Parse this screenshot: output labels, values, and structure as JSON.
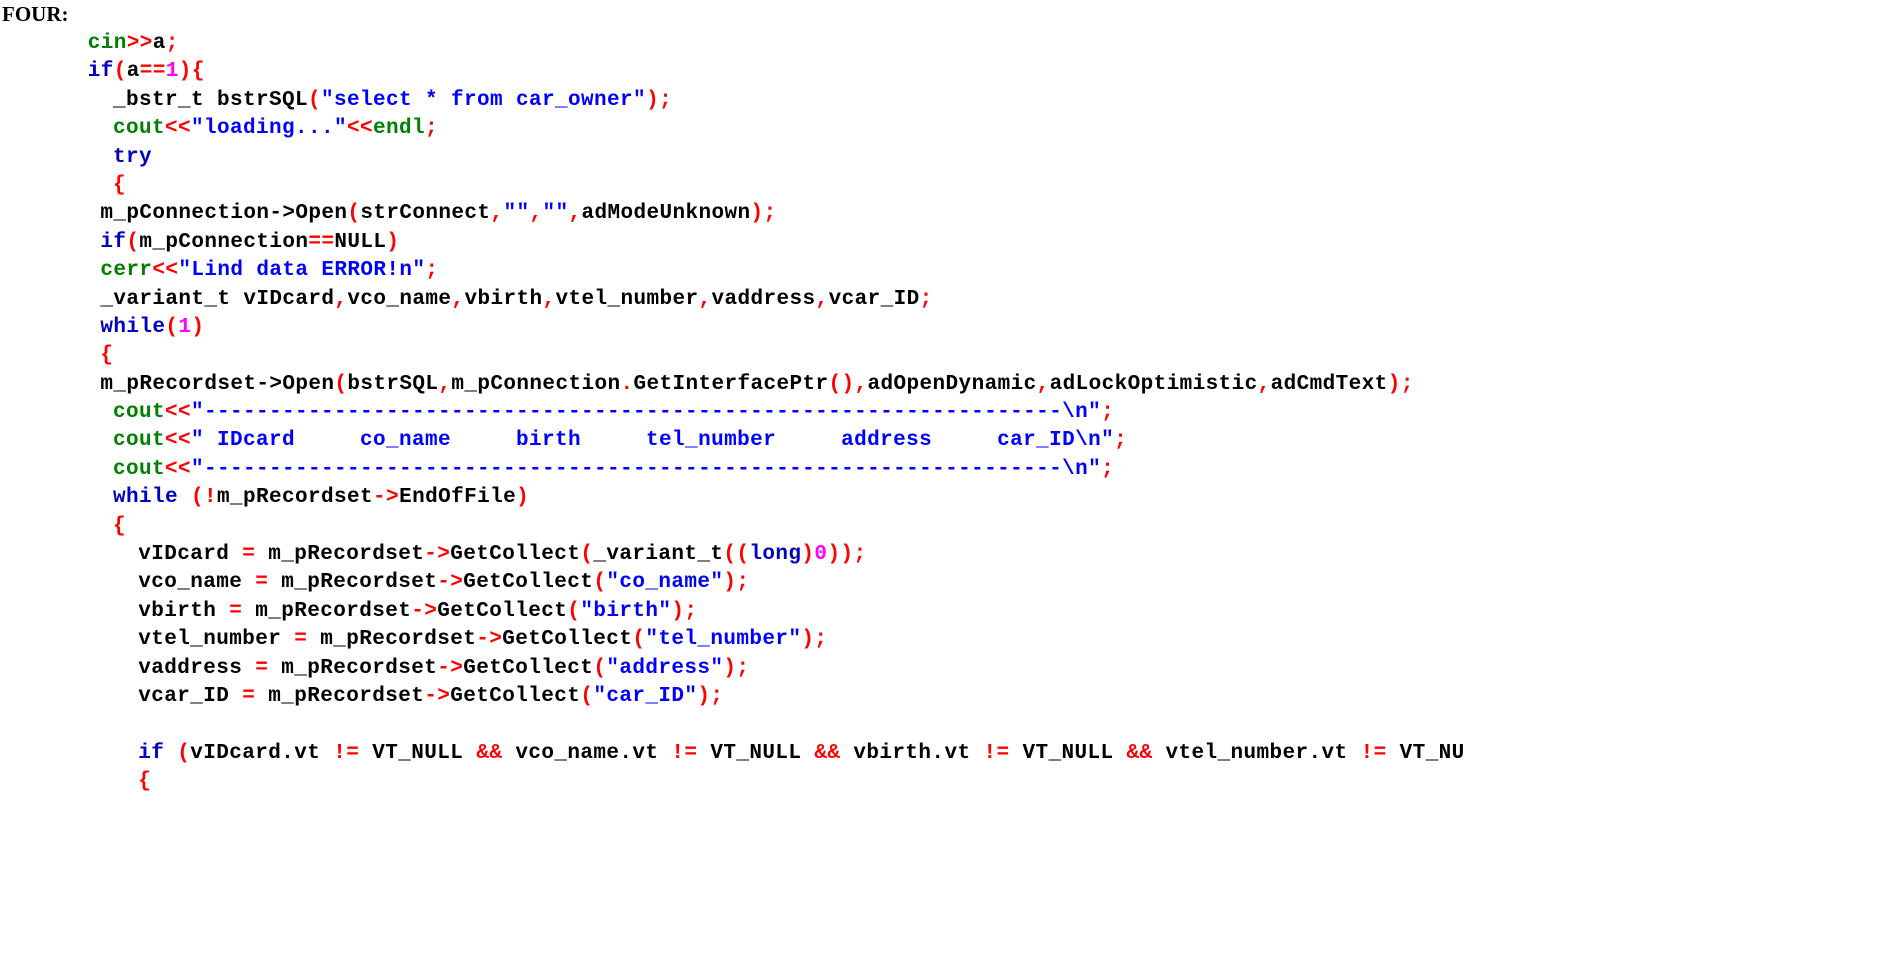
{
  "document": {
    "heading": "FOUR:",
    "language": "cpp",
    "background_color": "#ffffff",
    "colors": {
      "plain": "#000000",
      "keyword": "#0000c0",
      "string": "#0000ff",
      "stream_object": "#008000",
      "punctuation": "#ff0000",
      "number": "#ff00ff",
      "operator": "#ff0000"
    }
  },
  "code": {
    "lines": [
      {
        "indent": 6,
        "tokens": [
          {
            "t": "cin",
            "c": "stream"
          },
          {
            "t": ">>",
            "c": "punctuation"
          },
          {
            "t": "a",
            "c": "plain"
          },
          {
            "t": ";",
            "c": "punctuation"
          }
        ],
        "plain_text": "cin>>a;"
      },
      {
        "indent": 6,
        "tokens": [
          {
            "t": "if",
            "c": "keyword"
          },
          {
            "t": "(",
            "c": "punctuation"
          },
          {
            "t": "a",
            "c": "plain"
          },
          {
            "t": "==",
            "c": "operator"
          },
          {
            "t": "1",
            "c": "number"
          },
          {
            "t": ")",
            "c": "punctuation"
          },
          {
            "t": "{",
            "c": "punctuation"
          }
        ],
        "plain_text": "if(a==1){"
      },
      {
        "indent": 8,
        "tokens": [
          {
            "t": "_bstr_t bstrSQL",
            "c": "plain"
          },
          {
            "t": "(",
            "c": "punctuation"
          },
          {
            "t": "\"select * from car_owner\"",
            "c": "string"
          },
          {
            "t": ")",
            "c": "punctuation"
          },
          {
            "t": ";",
            "c": "punctuation"
          }
        ],
        "plain_text": "_bstr_t bstrSQL(\"select * from car_owner\");"
      },
      {
        "indent": 8,
        "tokens": [
          {
            "t": "cout",
            "c": "stream"
          },
          {
            "t": "<<",
            "c": "punctuation"
          },
          {
            "t": "\"loading...\"",
            "c": "string"
          },
          {
            "t": "<<",
            "c": "punctuation"
          },
          {
            "t": "endl",
            "c": "stream"
          },
          {
            "t": ";",
            "c": "punctuation"
          }
        ],
        "plain_text": "cout<<\"loading...\"<<endl;"
      },
      {
        "indent": 8,
        "tokens": [
          {
            "t": "try",
            "c": "keyword"
          }
        ],
        "plain_text": "try"
      },
      {
        "indent": 8,
        "tokens": [
          {
            "t": "{",
            "c": "punctuation"
          }
        ],
        "plain_text": "{"
      },
      {
        "indent": 7,
        "tokens": [
          {
            "t": "m_pConnection->Open",
            "c": "plain"
          },
          {
            "t": "(",
            "c": "punctuation"
          },
          {
            "t": "strConnect",
            "c": "plain"
          },
          {
            "t": ",",
            "c": "punctuation"
          },
          {
            "t": "\"\"",
            "c": "string"
          },
          {
            "t": ",",
            "c": "punctuation"
          },
          {
            "t": "\"\"",
            "c": "string"
          },
          {
            "t": ",",
            "c": "punctuation"
          },
          {
            "t": "adModeUnknown",
            "c": "plain"
          },
          {
            "t": ")",
            "c": "punctuation"
          },
          {
            "t": ";",
            "c": "punctuation"
          }
        ],
        "plain_text": "m_pConnection->Open(strConnect,\"\",\"\",adModeUnknown);"
      },
      {
        "indent": 7,
        "tokens": [
          {
            "t": "if",
            "c": "keyword"
          },
          {
            "t": "(",
            "c": "punctuation"
          },
          {
            "t": "m_pConnection",
            "c": "plain"
          },
          {
            "t": "==",
            "c": "operator"
          },
          {
            "t": "NULL",
            "c": "plain"
          },
          {
            "t": ")",
            "c": "punctuation"
          }
        ],
        "plain_text": "if(m_pConnection==NULL)"
      },
      {
        "indent": 7,
        "tokens": [
          {
            "t": "cerr",
            "c": "stream"
          },
          {
            "t": "<<",
            "c": "punctuation"
          },
          {
            "t": "\"Lind data ERROR!n\"",
            "c": "string"
          },
          {
            "t": ";",
            "c": "punctuation"
          }
        ],
        "plain_text": "cerr<<\"Lind data ERROR!n\";"
      },
      {
        "indent": 7,
        "tokens": [
          {
            "t": "_variant_t vIDcard",
            "c": "plain"
          },
          {
            "t": ",",
            "c": "punctuation"
          },
          {
            "t": "vco_name",
            "c": "plain"
          },
          {
            "t": ",",
            "c": "punctuation"
          },
          {
            "t": "vbirth",
            "c": "plain"
          },
          {
            "t": ",",
            "c": "punctuation"
          },
          {
            "t": "vtel_number",
            "c": "plain"
          },
          {
            "t": ",",
            "c": "punctuation"
          },
          {
            "t": "vaddress",
            "c": "plain"
          },
          {
            "t": ",",
            "c": "punctuation"
          },
          {
            "t": "vcar_ID",
            "c": "plain"
          },
          {
            "t": ";",
            "c": "punctuation"
          }
        ],
        "plain_text": "_variant_t vIDcard,vco_name,vbirth,vtel_number,vaddress,vcar_ID;"
      },
      {
        "indent": 7,
        "tokens": [
          {
            "t": "while",
            "c": "keyword"
          },
          {
            "t": "(",
            "c": "punctuation"
          },
          {
            "t": "1",
            "c": "number"
          },
          {
            "t": ")",
            "c": "punctuation"
          }
        ],
        "plain_text": "while(1)"
      },
      {
        "indent": 7,
        "tokens": [
          {
            "t": "{",
            "c": "punctuation"
          }
        ],
        "plain_text": "{"
      },
      {
        "indent": 7,
        "tokens": [
          {
            "t": "m_pRecordset->Open",
            "c": "plain"
          },
          {
            "t": "(",
            "c": "punctuation"
          },
          {
            "t": "bstrSQL",
            "c": "plain"
          },
          {
            "t": ",",
            "c": "punctuation"
          },
          {
            "t": "m_pConnection",
            "c": "plain"
          },
          {
            "t": ".",
            "c": "punctuation"
          },
          {
            "t": "GetInterfacePtr",
            "c": "plain"
          },
          {
            "t": "(",
            "c": "punctuation"
          },
          {
            "t": ")",
            "c": "punctuation"
          },
          {
            "t": ",",
            "c": "punctuation"
          },
          {
            "t": "adOpenDynamic",
            "c": "plain"
          },
          {
            "t": ",",
            "c": "punctuation"
          },
          {
            "t": "adLockOptimistic",
            "c": "plain"
          },
          {
            "t": ",",
            "c": "punctuation"
          },
          {
            "t": "adCmdText",
            "c": "plain"
          },
          {
            "t": ")",
            "c": "punctuation"
          },
          {
            "t": ";",
            "c": "punctuation"
          }
        ],
        "plain_text": "m_pRecordset->Open(bstrSQL,m_pConnection.GetInterfacePtr(),adOpenDynamic,adLockOptimistic,adCmdText);"
      },
      {
        "indent": 8,
        "tokens": [
          {
            "t": "cout",
            "c": "stream"
          },
          {
            "t": "<<",
            "c": "punctuation"
          },
          {
            "t": "\"------------------------------------------------------------------",
            "c": "string"
          },
          {
            "t": "\\n",
            "c": "string"
          },
          {
            "t": "\"",
            "c": "string"
          },
          {
            "t": ";",
            "c": "punctuation"
          }
        ],
        "plain_text": "cout<<\"------------------------------------------------------------------\\n\";"
      },
      {
        "indent": 8,
        "tokens": [
          {
            "t": "cout",
            "c": "stream"
          },
          {
            "t": "<<",
            "c": "punctuation"
          },
          {
            "t": "\" IDcard     co_name     birth     tel_number     address     car_ID\\n\"",
            "c": "string"
          },
          {
            "t": ";",
            "c": "punctuation"
          }
        ],
        "plain_text": "cout<<\" IDcard     co_name     birth     tel_number     address     car_ID\\n\";"
      },
      {
        "indent": 8,
        "tokens": [
          {
            "t": "cout",
            "c": "stream"
          },
          {
            "t": "<<",
            "c": "punctuation"
          },
          {
            "t": "\"------------------------------------------------------------------",
            "c": "string"
          },
          {
            "t": "\\n",
            "c": "string"
          },
          {
            "t": "\"",
            "c": "string"
          },
          {
            "t": ";",
            "c": "punctuation"
          }
        ],
        "plain_text": "cout<<\"------------------------------------------------------------------\\n\";"
      },
      {
        "indent": 8,
        "tokens": [
          {
            "t": "while",
            "c": "keyword"
          },
          {
            "t": " ",
            "c": "plain"
          },
          {
            "t": "(",
            "c": "punctuation"
          },
          {
            "t": "!",
            "c": "operator"
          },
          {
            "t": "m_pRecordset",
            "c": "plain"
          },
          {
            "t": "->",
            "c": "punctuation"
          },
          {
            "t": "EndOfFile",
            "c": "plain"
          },
          {
            "t": ")",
            "c": "punctuation"
          }
        ],
        "plain_text": "while (!m_pRecordset->EndOfFile)"
      },
      {
        "indent": 8,
        "tokens": [
          {
            "t": "{",
            "c": "punctuation"
          }
        ],
        "plain_text": "{"
      },
      {
        "indent": 10,
        "tokens": [
          {
            "t": "vIDcard ",
            "c": "plain"
          },
          {
            "t": "=",
            "c": "operator"
          },
          {
            "t": " m_pRecordset",
            "c": "plain"
          },
          {
            "t": "->",
            "c": "punctuation"
          },
          {
            "t": "GetCollect",
            "c": "plain"
          },
          {
            "t": "(",
            "c": "punctuation"
          },
          {
            "t": "_variant_t",
            "c": "plain"
          },
          {
            "t": "(",
            "c": "punctuation"
          },
          {
            "t": "(",
            "c": "punctuation"
          },
          {
            "t": "long",
            "c": "keyword"
          },
          {
            "t": ")",
            "c": "punctuation"
          },
          {
            "t": "0",
            "c": "number"
          },
          {
            "t": ")",
            "c": "punctuation"
          },
          {
            "t": ")",
            "c": "punctuation"
          },
          {
            "t": ";",
            "c": "punctuation"
          }
        ],
        "plain_text": "vIDcard = m_pRecordset->GetCollect(_variant_t((long)0));"
      },
      {
        "indent": 10,
        "tokens": [
          {
            "t": "vco_name ",
            "c": "plain"
          },
          {
            "t": "=",
            "c": "operator"
          },
          {
            "t": " m_pRecordset",
            "c": "plain"
          },
          {
            "t": "->",
            "c": "punctuation"
          },
          {
            "t": "GetCollect",
            "c": "plain"
          },
          {
            "t": "(",
            "c": "punctuation"
          },
          {
            "t": "\"co_name\"",
            "c": "string"
          },
          {
            "t": ")",
            "c": "punctuation"
          },
          {
            "t": ";",
            "c": "punctuation"
          }
        ],
        "plain_text": "vco_name = m_pRecordset->GetCollect(\"co_name\");"
      },
      {
        "indent": 10,
        "tokens": [
          {
            "t": "vbirth ",
            "c": "plain"
          },
          {
            "t": "=",
            "c": "operator"
          },
          {
            "t": " m_pRecordset",
            "c": "plain"
          },
          {
            "t": "->",
            "c": "punctuation"
          },
          {
            "t": "GetCollect",
            "c": "plain"
          },
          {
            "t": "(",
            "c": "punctuation"
          },
          {
            "t": "\"birth\"",
            "c": "string"
          },
          {
            "t": ")",
            "c": "punctuation"
          },
          {
            "t": ";",
            "c": "punctuation"
          }
        ],
        "plain_text": "vbirth = m_pRecordset->GetCollect(\"birth\");"
      },
      {
        "indent": 10,
        "tokens": [
          {
            "t": "vtel_number ",
            "c": "plain"
          },
          {
            "t": "=",
            "c": "operator"
          },
          {
            "t": " m_pRecordset",
            "c": "plain"
          },
          {
            "t": "->",
            "c": "punctuation"
          },
          {
            "t": "GetCollect",
            "c": "plain"
          },
          {
            "t": "(",
            "c": "punctuation"
          },
          {
            "t": "\"tel_number\"",
            "c": "string"
          },
          {
            "t": ")",
            "c": "punctuation"
          },
          {
            "t": ";",
            "c": "punctuation"
          }
        ],
        "plain_text": "vtel_number = m_pRecordset->GetCollect(\"tel_number\");"
      },
      {
        "indent": 10,
        "tokens": [
          {
            "t": "vaddress ",
            "c": "plain"
          },
          {
            "t": "=",
            "c": "operator"
          },
          {
            "t": " m_pRecordset",
            "c": "plain"
          },
          {
            "t": "->",
            "c": "punctuation"
          },
          {
            "t": "GetCollect",
            "c": "plain"
          },
          {
            "t": "(",
            "c": "punctuation"
          },
          {
            "t": "\"address\"",
            "c": "string"
          },
          {
            "t": ")",
            "c": "punctuation"
          },
          {
            "t": ";",
            "c": "punctuation"
          }
        ],
        "plain_text": "vaddress = m_pRecordset->GetCollect(\"address\");"
      },
      {
        "indent": 10,
        "tokens": [
          {
            "t": "vcar_ID ",
            "c": "plain"
          },
          {
            "t": "=",
            "c": "operator"
          },
          {
            "t": " m_pRecordset",
            "c": "plain"
          },
          {
            "t": "->",
            "c": "punctuation"
          },
          {
            "t": "GetCollect",
            "c": "plain"
          },
          {
            "t": "(",
            "c": "punctuation"
          },
          {
            "t": "\"car_ID\"",
            "c": "string"
          },
          {
            "t": ")",
            "c": "punctuation"
          },
          {
            "t": ";",
            "c": "punctuation"
          }
        ],
        "plain_text": "vcar_ID = m_pRecordset->GetCollect(\"car_ID\");"
      },
      {
        "indent": 0,
        "tokens": [],
        "plain_text": ""
      },
      {
        "indent": 10,
        "tokens": [
          {
            "t": "if",
            "c": "keyword"
          },
          {
            "t": " ",
            "c": "plain"
          },
          {
            "t": "(",
            "c": "punctuation"
          },
          {
            "t": "vIDcard.vt ",
            "c": "plain"
          },
          {
            "t": "!=",
            "c": "operator"
          },
          {
            "t": " VT_NULL ",
            "c": "plain"
          },
          {
            "t": "&&",
            "c": "operator"
          },
          {
            "t": " vco_name.vt ",
            "c": "plain"
          },
          {
            "t": "!=",
            "c": "operator"
          },
          {
            "t": " VT_NULL ",
            "c": "plain"
          },
          {
            "t": "&&",
            "c": "operator"
          },
          {
            "t": " vbirth.vt ",
            "c": "plain"
          },
          {
            "t": "!=",
            "c": "operator"
          },
          {
            "t": " VT_NULL ",
            "c": "plain"
          },
          {
            "t": "&&",
            "c": "operator"
          },
          {
            "t": " vtel_number.vt ",
            "c": "plain"
          },
          {
            "t": "!=",
            "c": "operator"
          },
          {
            "t": " VT_NU",
            "c": "plain"
          }
        ],
        "plain_text": "if (vIDcard.vt != VT_NULL && vco_name.vt != VT_NULL && vbirth.vt != VT_NULL && vtel_number.vt != VT_NU"
      },
      {
        "indent": 10,
        "tokens": [
          {
            "t": "{",
            "c": "punctuation"
          }
        ],
        "plain_text": "{"
      }
    ]
  }
}
